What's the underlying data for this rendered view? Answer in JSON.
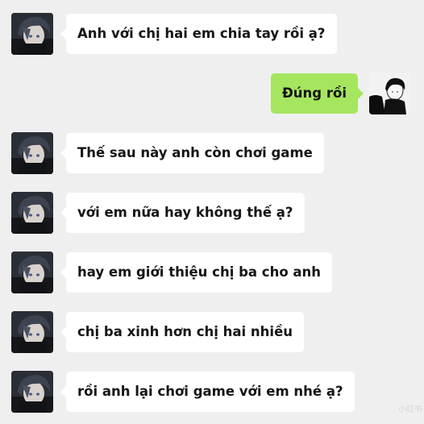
{
  "colors": {
    "background": "#efefef",
    "incoming_bubble": "#ffffff",
    "outgoing_bubble": "#a6e65f",
    "text": "#151515"
  },
  "messages": [
    {
      "sender": "other",
      "avatar": "dark-haired-boy-avatar",
      "text": "Anh với chị hai em chia tay rồi ạ?"
    },
    {
      "sender": "me",
      "avatar": "monochrome-boy-avatar",
      "text": "Đúng rồi"
    },
    {
      "sender": "other",
      "avatar": "dark-haired-boy-avatar",
      "text": "Thế sau này anh còn chơi game"
    },
    {
      "sender": "other",
      "avatar": "dark-haired-boy-avatar",
      "text": "với em nữa hay không thế ạ?"
    },
    {
      "sender": "other",
      "avatar": "dark-haired-boy-avatar",
      "text": "hay em giới thiệu chị ba cho anh"
    },
    {
      "sender": "other",
      "avatar": "dark-haired-boy-avatar",
      "text": "chị ba xinh hơn chị hai nhiều"
    },
    {
      "sender": "other",
      "avatar": "dark-haired-boy-avatar",
      "text": "rồi anh lại chơi game với em nhé ạ?"
    }
  ],
  "watermark": "小红书"
}
